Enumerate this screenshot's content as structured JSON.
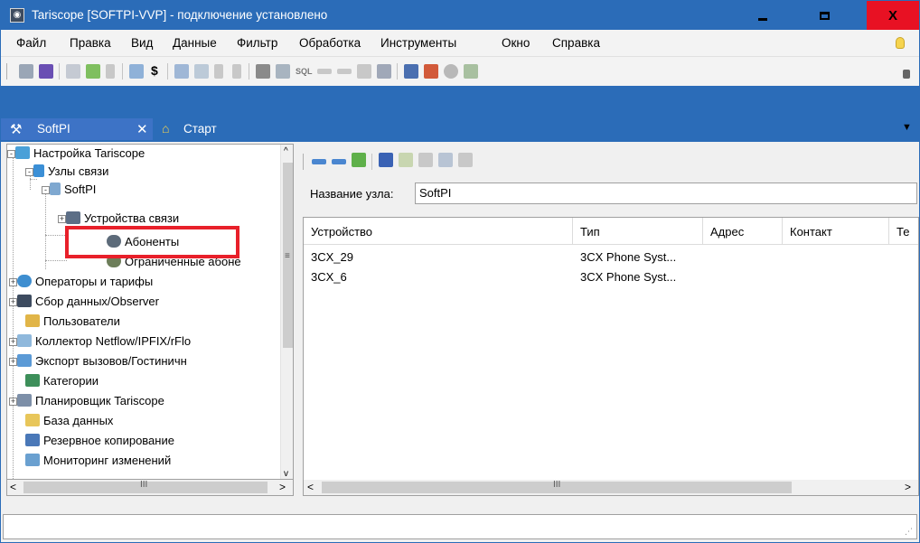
{
  "window": {
    "title": "Tariscope [SOFTPI-VVP] - подключение установлено",
    "app_icon": "tariscope-icon",
    "controls": {
      "minimize": "minimize-icon",
      "maximize": "maximize-icon",
      "close": "X"
    }
  },
  "menu": {
    "items": [
      "Файл",
      "Правка",
      "Вид",
      "Данные",
      "Фильтр",
      "Обработка",
      "Инструменты",
      "Окно",
      "Справка"
    ]
  },
  "toolbar": {
    "dollar_text": "$",
    "sql_text": "SQL"
  },
  "tabs": [
    {
      "label": "SoftPI",
      "close": "✕",
      "icon": "tools-icon",
      "active": true
    },
    {
      "label": "Старт",
      "icon": "home-icon",
      "active": false
    }
  ],
  "tree": {
    "root": "Настройка Tariscope",
    "nodes": {
      "link_nodes": "Узлы связи",
      "softpi": "SoftPI",
      "devices": "Устройства связи",
      "subscribers": "Абоненты",
      "restricted": "Ограниченные абоне",
      "operators": "Операторы и тарифы",
      "data_collection": "Сбор данных/Observer",
      "users": "Пользователи",
      "netflow": "Коллектор Netflow/IPFIX/rFlo",
      "export": "Экспорт вызовов/Гостиничн",
      "categories": "Категории",
      "scheduler": "Планировщик Tariscope",
      "database": "База данных",
      "backup": "Резервное копирование",
      "monitoring": "Мониторинг изменений"
    }
  },
  "node_form": {
    "label": "Название узла:",
    "value": "SoftPI"
  },
  "grid": {
    "columns": [
      "Устройство",
      "Тип",
      "Адрес",
      "Контакт",
      "Те"
    ],
    "rows": [
      [
        "3CX_29",
        "3CX Phone Syst..."
      ],
      [
        "3CX_6",
        "3CX Phone Syst..."
      ]
    ]
  },
  "scroll": {
    "grip": "III",
    "left": "<",
    "right": ">",
    "up": "^",
    "down": "v"
  }
}
